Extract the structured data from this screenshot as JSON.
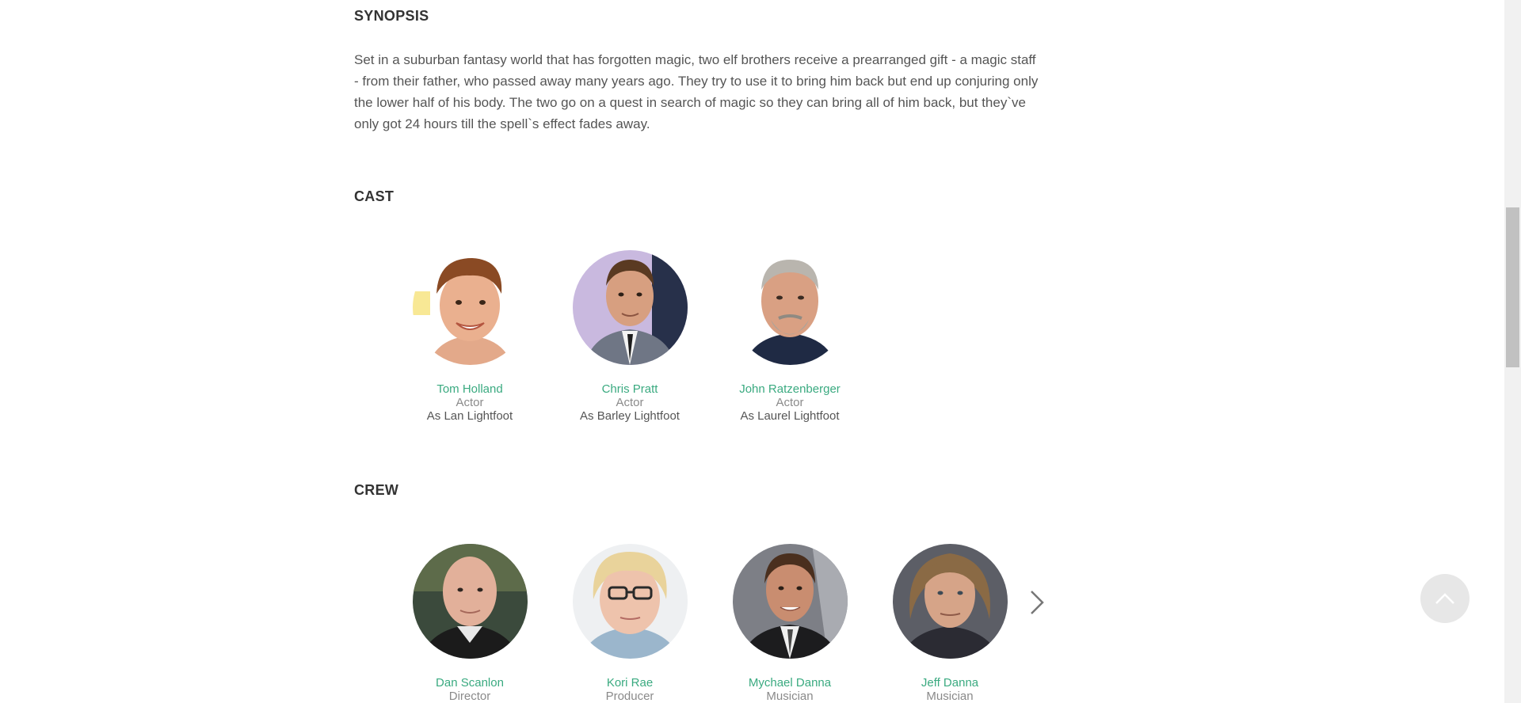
{
  "synopsis": {
    "title": "SYNOPSIS",
    "text": "Set in a suburban fantasy world that has forgotten magic, two elf brothers receive a prearranged gift - a magic staff - from their father, who passed away many years ago. They try to use it to bring him back but end up conjuring only the lower half of his body. The two go on a quest in search of magic so they can bring all of him back, but they`ve only got 24 hours till the spell`s effect fades away."
  },
  "cast": {
    "title": "CAST",
    "people": [
      {
        "name": "Tom Holland",
        "role": "Actor",
        "character": "As Lan Lightfoot"
      },
      {
        "name": "Chris Pratt",
        "role": "Actor",
        "character": "As Barley Lightfoot"
      },
      {
        "name": "John Ratzenberger",
        "role": "Actor",
        "character": "As Laurel Lightfoot"
      }
    ]
  },
  "crew": {
    "title": "CREW",
    "people": [
      {
        "name": "Dan Scanlon",
        "role": "Director"
      },
      {
        "name": "Kori Rae",
        "role": "Producer"
      },
      {
        "name": "Mychael Danna",
        "role": "Musician"
      },
      {
        "name": "Jeff Danna",
        "role": "Musician"
      }
    ]
  },
  "icons": {
    "next": "chevron-right-icon",
    "scroll_top": "chevron-up-icon"
  },
  "colors": {
    "name_link": "#3aaa80",
    "role": "#8a8a8a",
    "text": "#555555"
  }
}
